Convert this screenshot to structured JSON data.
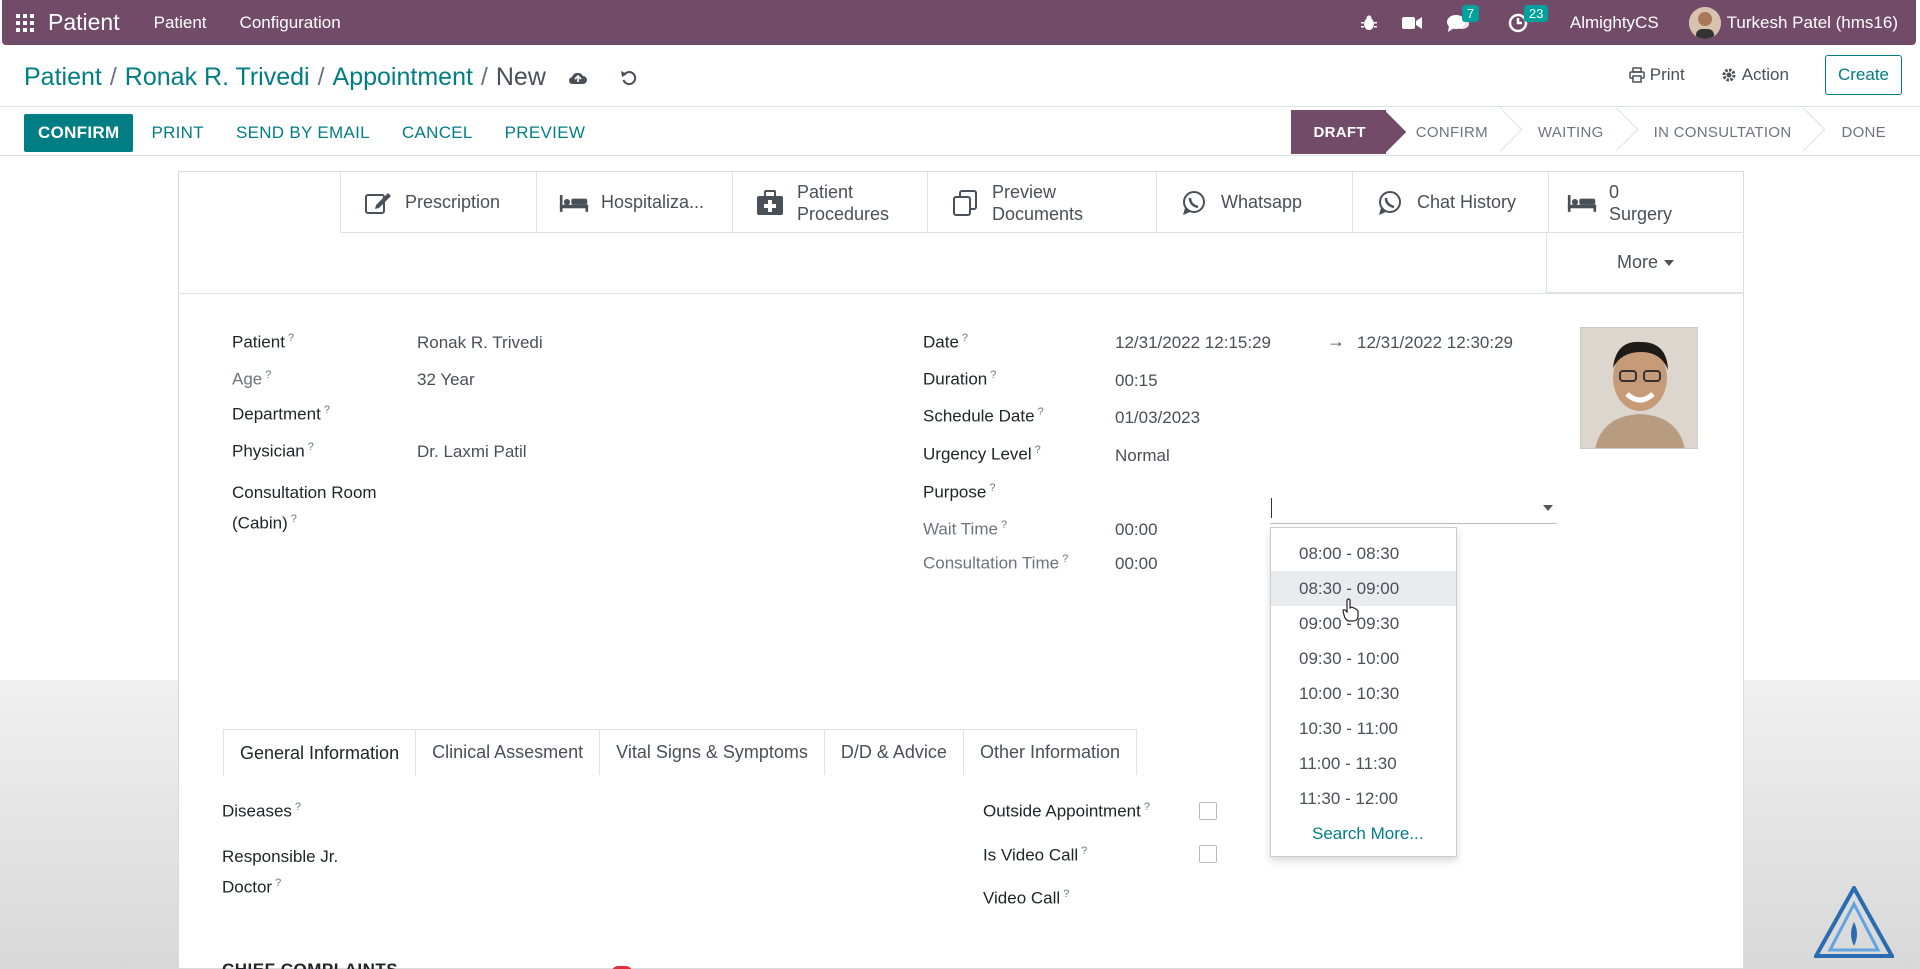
{
  "navbar": {
    "app_name": "Patient",
    "menus": [
      "Patient",
      "Configuration"
    ],
    "chat_count": "7",
    "activity_count": "23",
    "company": "AlmightyCS",
    "user": "Turkesh Patel (hms16)",
    "color": "#714b67"
  },
  "breadcrumb": {
    "items": [
      "Patient",
      "Ronak R. Trivedi",
      "Appointment"
    ],
    "current": "New"
  },
  "header_actions": {
    "print": "Print",
    "action": "Action",
    "create": "Create"
  },
  "buttons": {
    "confirm": "CONFIRM",
    "print": "PRINT",
    "send_email": "SEND BY EMAIL",
    "cancel": "CANCEL",
    "preview": "PREVIEW"
  },
  "stages": [
    "DRAFT",
    "CONFIRM",
    "WAITING",
    "IN CONSULTATION",
    "DONE"
  ],
  "active_stage": "DRAFT",
  "smart_buttons": {
    "prescription": "Prescription",
    "hospitalization": "Hospitaliza...",
    "patient_procedures_1": "Patient",
    "patient_procedures_2": "Procedures",
    "preview_documents_1": "Preview",
    "preview_documents_2": "Documents",
    "whatsapp": "Whatsapp",
    "chat_history": "Chat History",
    "surgery_count": "0",
    "surgery_label": "Surgery",
    "more": "More"
  },
  "left_fields": {
    "patient_label": "Patient",
    "patient_value": "Ronak R. Trivedi",
    "age_label": "Age",
    "age_value": "32 Year",
    "department_label": "Department",
    "physician_label": "Physician",
    "physician_value": "Dr. Laxmi Patil",
    "room_label_1": "Consultation Room",
    "room_label_2": "(Cabin)"
  },
  "right_fields": {
    "date_label": "Date",
    "date_start": "12/31/2022 12:15:29",
    "date_arrow": "→",
    "date_end": "12/31/2022 12:30:29",
    "duration_label": "Duration",
    "duration_value": "00:15",
    "schedule_label": "Schedule Date",
    "schedule_value": "01/03/2023",
    "urgency_label": "Urgency Level",
    "urgency_value": "Normal",
    "purpose_label": "Purpose",
    "wait_label": "Wait Time",
    "wait_value": "00:00",
    "consult_label": "Consultation Time",
    "consult_value": "00:00"
  },
  "help_mark": "?",
  "tabs": [
    "General Information",
    "Clinical Assesment",
    "Vital Signs & Symptoms",
    "D/D & Advice",
    "Other Information"
  ],
  "general_info": {
    "diseases_label": "Diseases",
    "jr_doctor_label_1": "Responsible Jr.",
    "jr_doctor_label_2": "Doctor",
    "outside_label": "Outside Appointment",
    "video_call_check_label": "Is Video Call",
    "video_call_label": "Video Call"
  },
  "section_heading": "CHIEF COMPLAINTS",
  "slot_dropdown": {
    "options": [
      "08:00 - 08:30",
      "08:30 - 09:00",
      "09:00 - 09:30",
      "09:30 - 10:00",
      "10:00 - 10:30",
      "10:30 - 11:00",
      "11:00 - 11:30",
      "11:30 - 12:00"
    ],
    "hovered": "08:30 - 09:00",
    "search_more": "Search More..."
  },
  "accent": "#017e84"
}
